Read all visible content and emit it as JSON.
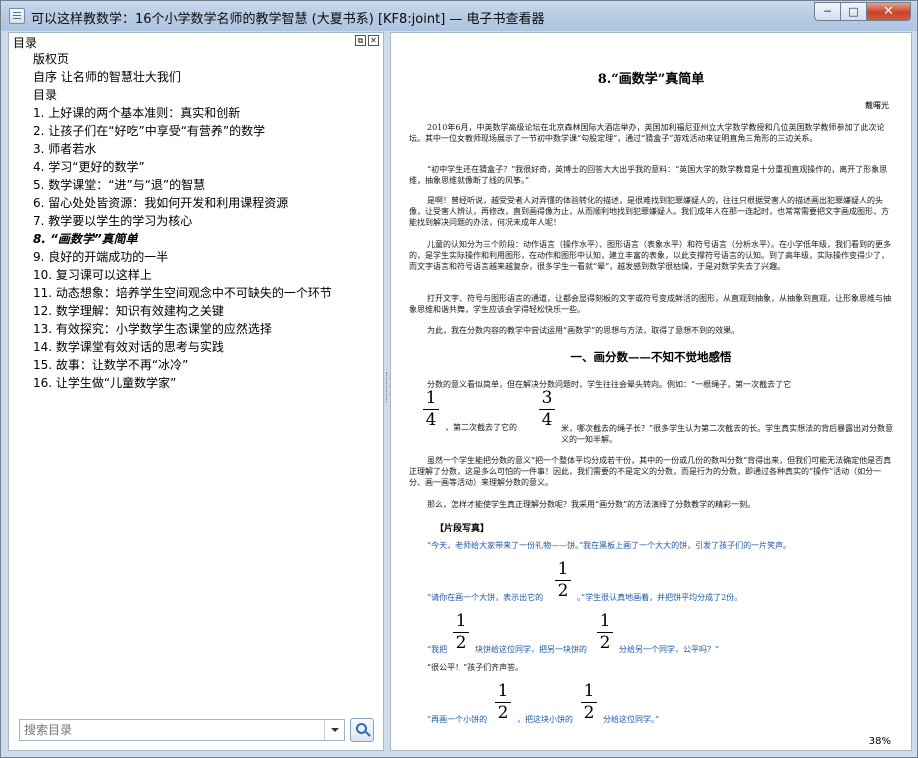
{
  "window": {
    "title": "可以这样教数学：16个小学数学名师的教学智慧 (大夏书系) [KF8:joint] — 电子书查看器",
    "minimize_label": "─",
    "maximize_label": "□",
    "close_label": "✕"
  },
  "sidebar": {
    "title": "目录",
    "float_icon": "⧉",
    "close_icon": "✕",
    "items": [
      "版权页",
      "自序 让名师的智慧壮大我们",
      "目录",
      "1. 上好课的两个基本准则：真实和创新",
      "2. 让孩子们在“好吃”中享受“有营养”的数学",
      "3. 师者若水",
      "4. 学习“更好的数学”",
      "5. 数学课堂：“进”与“退”的智慧",
      "6. 留心处处皆资源：我如何开发和利用课程资源",
      "7. 教学要以学生的学习为核心",
      "8. “画数学”真简单",
      "9. 良好的开端成功的一半",
      "10. 复习课可以这样上",
      "11. 动态想象：培养学生空间观念中不可缺失的一个环节",
      "12. 数学理解：知识有效建构之关键",
      "13. 有效探究：小学数学生态课堂的应然选择",
      "14. 数学课堂有效对话的思考与实践",
      "15. 故事：让数学不再“冰冷”",
      "16. 让学生做“儿童数学家”"
    ],
    "current_index": 10,
    "search_placeholder": "搜索目录"
  },
  "document": {
    "chapter_title": "8.“画数学”真简单",
    "author": "戴曙光",
    "paragraphs": [
      "2010年6月，中英数学高级论坛在北京森林国际大酒店举办，英国加利福尼亚州立大学数学教授和几位英国数学教师参加了此次论坛。其中一位女教师现场展示了一节初中数学课“勾股定理”，通过“猜盒子”游戏活动来证明直角三角形的三边关系。",
      "“初中学生还在猜盒子？”我很好奇，英博士的回答大大出乎我的意料：“英国大学的数学教育是十分重视直观操作的，离开了形象思维，抽象思维就像断了线的风筝。”",
      "是啊！曾经听说，越受受者人对弄懂的体验转化的描述，是很难找到犯罪嫌疑人的，往往只根据受害人的描述画出犯罪嫌疑人的头像，让受害人辨认，再修改，直到画得像为止，从而顺利地找到犯罪嫌疑人。我们成年人在那一连起时，也常常需要把文字画成图形，方能找到解决问题的办法，何况未成年人呢！",
      "儿童的认知分为三个阶段：动作语言（操作水平）、图形语言（表象水平）和符号语言（分析水平）。在小学低年级，我们看到的更多的，是学生实际操作和利用图形，在动作和图形中认知，建立丰富的表象，以此支撑符号语言的认知。到了高年级，实际操作变得少了，而文字语言和符号语言越来越复杂，很多学生一看就“晕”，越发感到数学很枯燥，于是对数学失去了兴趣。",
      "打开文字、符号与图形语言的通道，让都会显得刻板的文字或符号变成鲜活的图形，从直观到抽象，从抽象到直观，让形象思维与抽象思维和谐共舞，学生应该会学得轻松快乐一些。",
      "为此，我在分数内容的教学中尝试运用“画数学”的思想与方法，取得了意想不到的效果。"
    ],
    "section_title": "一、画分数——不知不觉地感悟",
    "section_para1": "分数的意义看似简单，但在解决分数问题时，学生往往会晕头转向。例如：“一根绳子，第一次截去了它",
    "section_para1b": "，第二次截去了它的",
    "section_para1c": "米，哪次截去的绳子长？”很多学生认为第二次截去的长。学生真实想法的背后暴露出对分数意义的一知半解。",
    "section_para2": "虽然一个学生能把分数的意义“把一个整体平均分成若干份，其中的一份或几份的数叫分数”背得出来，但我们可能无法确定他是否真正理解了分数，这是多么可怕的一件事！因此，我们需要的不是定义的分数，而是行为的分数，即通过各种真实的“操作”活动（如分一分、画一画等活动）来理解分数的意义。",
    "section_para3": "那么，怎样才能使学生真正理解分数呢？我采用“画分数”的方法演绎了分数教学的精彩一刻。",
    "clip_label": "【片段写真】",
    "dialog": [
      "“今天，老师给大家带来了一份礼物——饼。”我在黑板上画了一个大大的饼，引发了孩子们的一片笑声。",
      "“请你在画一个大饼，表示出它的",
      "。”学生很认真地画着，并把饼平均分成了2份。",
      "“我把",
      "块饼给这位同学，把另一块饼的",
      "分给另一个同学，公平吗？”",
      "“很公平！”孩子们齐声答。",
      "“再画一个小饼的",
      "，把这块小饼的",
      "分给这位同学。”"
    ],
    "fractions": {
      "a": {
        "num": "1",
        "den": "4"
      },
      "b": {
        "num": "3",
        "den": "4"
      },
      "half": {
        "num": "1",
        "den": "2"
      }
    },
    "zoom": "38%"
  }
}
